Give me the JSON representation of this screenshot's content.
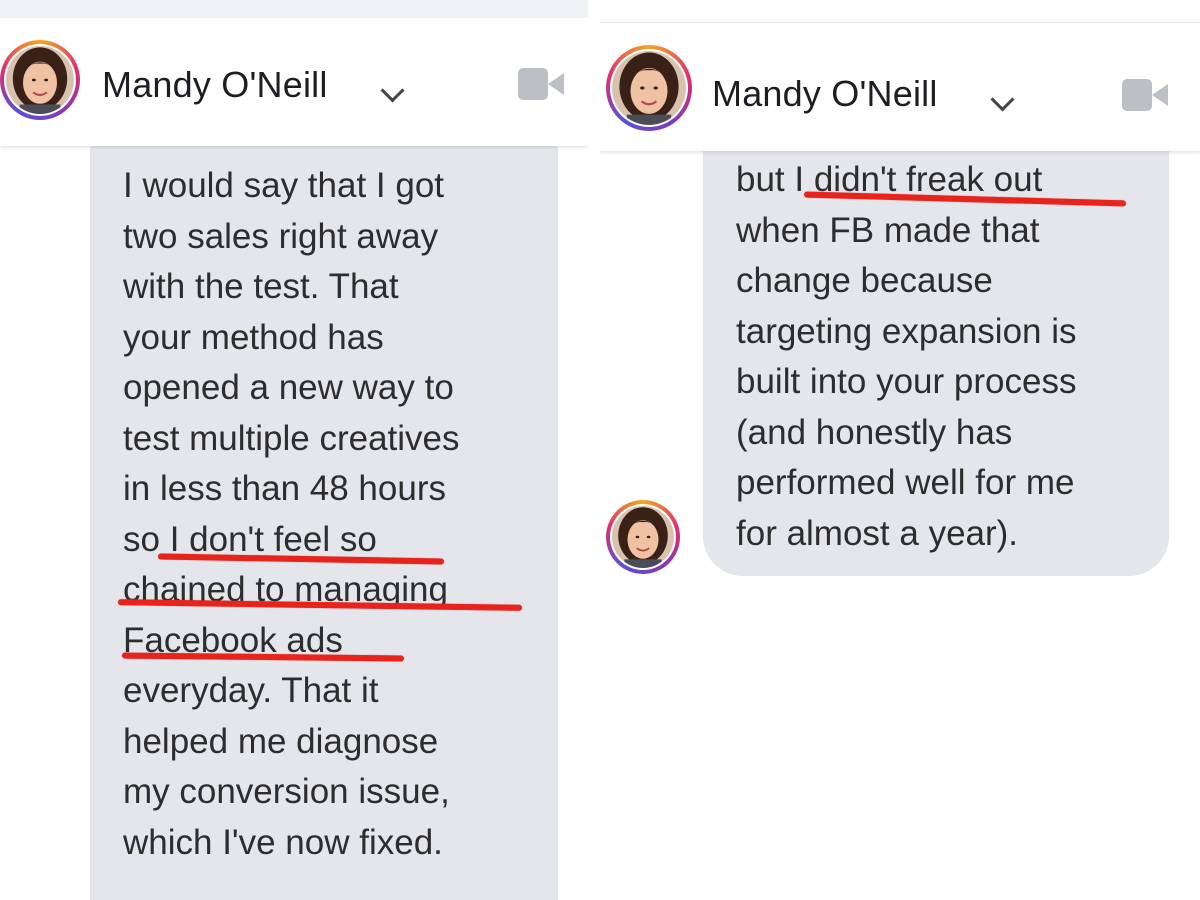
{
  "left": {
    "contact": {
      "name": "Mandy O'Neill"
    },
    "message": {
      "lines": [
        "I would say that I got",
        "two sales right away",
        "with the test. That",
        "your method has",
        "opened a new way to",
        "test multiple creatives",
        "in less than 48 hours",
        "so I don't feel so",
        "chained to managing",
        "Facebook ads",
        "everyday. That it",
        "helped me diagnose",
        "my conversion issue,",
        "which I've now fixed."
      ],
      "highlighted_text": "I don't feel so chained to managing Facebook ads"
    }
  },
  "right": {
    "contact": {
      "name": "Mandy O'Neill"
    },
    "message": {
      "lines": [
        "but I didn't freak out",
        "when FB made that",
        "change because",
        "targeting expansion is",
        "built into your process",
        "(and honestly has",
        "performed well for me",
        "for almost a year)."
      ],
      "highlighted_text": "I didn't freak out"
    }
  },
  "icons": {
    "header_dropdown": "chevron-down-icon",
    "header_call": "video-camera-icon"
  },
  "colors": {
    "bubble_background": "#e4e6eb",
    "highlight_underline": "#e8231c",
    "icon_gray": "#bcc0c4",
    "avatar_ring": [
      "#f6a623",
      "#e1306c",
      "#833ab4"
    ]
  }
}
